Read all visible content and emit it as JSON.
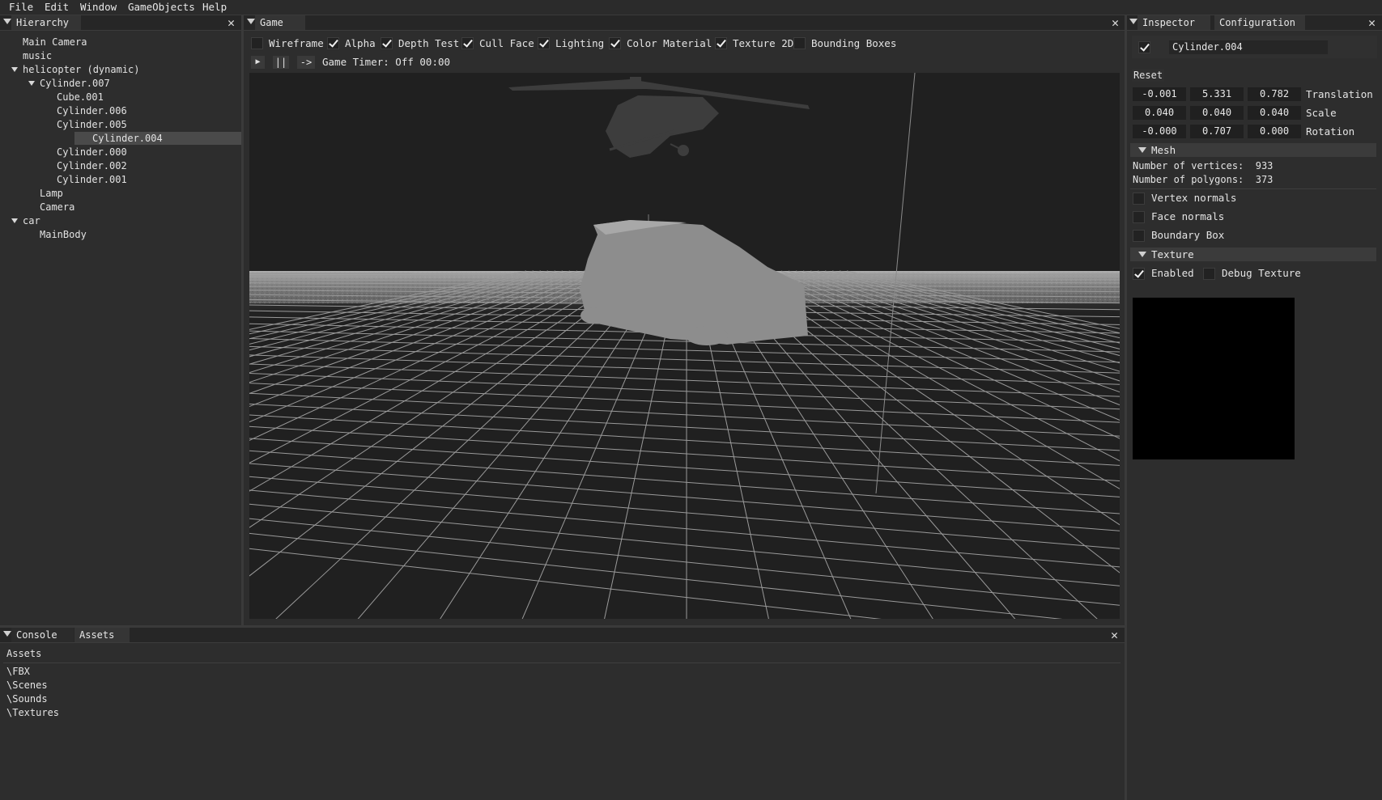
{
  "menu": [
    "File",
    "Edit",
    "Window",
    "GameObjects",
    "Help"
  ],
  "hierarchy": {
    "title": "Hierarchy",
    "items": [
      {
        "label": "Main Camera",
        "depth": 0,
        "expanded": null,
        "selected": false
      },
      {
        "label": "music",
        "depth": 0,
        "expanded": null,
        "selected": false
      },
      {
        "label": "helicopter (dynamic)",
        "depth": 0,
        "expanded": true,
        "selected": false
      },
      {
        "label": "Cylinder.007",
        "depth": 1,
        "expanded": true,
        "selected": false
      },
      {
        "label": "Cube.001",
        "depth": 2,
        "expanded": null,
        "selected": false
      },
      {
        "label": "Cylinder.006",
        "depth": 2,
        "expanded": null,
        "selected": false
      },
      {
        "label": "Cylinder.005",
        "depth": 2,
        "expanded": null,
        "selected": false
      },
      {
        "label": "Cylinder.004",
        "depth": 2,
        "expanded": null,
        "selected": true
      },
      {
        "label": "Cylinder.000",
        "depth": 2,
        "expanded": null,
        "selected": false
      },
      {
        "label": "Cylinder.002",
        "depth": 2,
        "expanded": null,
        "selected": false
      },
      {
        "label": "Cylinder.001",
        "depth": 2,
        "expanded": null,
        "selected": false
      },
      {
        "label": "Lamp",
        "depth": 1,
        "expanded": null,
        "selected": false
      },
      {
        "label": "Camera",
        "depth": 1,
        "expanded": null,
        "selected": false
      },
      {
        "label": "car",
        "depth": 0,
        "expanded": true,
        "selected": false
      },
      {
        "label": "MainBody",
        "depth": 1,
        "expanded": null,
        "selected": false
      }
    ]
  },
  "game": {
    "title": "Game",
    "options": [
      {
        "label": "Wireframe",
        "checked": false
      },
      {
        "label": "Alpha",
        "checked": true
      },
      {
        "label": "Depth Test",
        "checked": true
      },
      {
        "label": "Cull Face",
        "checked": true
      },
      {
        "label": "Lighting",
        "checked": true
      },
      {
        "label": "Color Material",
        "checked": true
      },
      {
        "label": "Texture 2D",
        "checked": true
      },
      {
        "label": "Bounding Boxes",
        "checked": false
      }
    ],
    "controls": {
      "play": "▶",
      "pause": "||",
      "step": "->"
    },
    "timer": "Game Timer: Off 00:00"
  },
  "inspector": {
    "tabs": [
      "Inspector",
      "Configuration"
    ],
    "active_checked": true,
    "name": "Cylinder.004",
    "reset_label": "Reset",
    "transform": [
      {
        "label": "Translation",
        "values": [
          "-0.001",
          "5.331",
          "0.782"
        ]
      },
      {
        "label": "Scale",
        "values": [
          "0.040",
          "0.040",
          "0.040"
        ]
      },
      {
        "label": "Rotation",
        "values": [
          "-0.000",
          "0.707",
          "0.000"
        ]
      }
    ],
    "mesh": {
      "title": "Mesh",
      "vertices": "Number of vertices:  933",
      "polygons": "Number of polygons:  373",
      "options": [
        {
          "label": "Vertex normals",
          "checked": false
        },
        {
          "label": "Face normals",
          "checked": false
        },
        {
          "label": "Boundary Box",
          "checked": false
        }
      ]
    },
    "texture": {
      "title": "Texture",
      "enabled_label": "Enabled",
      "enabled": true,
      "debug_label": "Debug Texture",
      "debug": false
    }
  },
  "console": {
    "tabs": [
      "Console",
      "Assets"
    ],
    "heading": "Assets",
    "folders": [
      "\\FBX",
      "\\Scenes",
      "\\Sounds",
      "\\Textures"
    ]
  },
  "colors": {
    "background": "#2d2d2d",
    "viewport": "#202020",
    "selection": "#4a4a4a",
    "accent_text": "#e6e6e6"
  }
}
